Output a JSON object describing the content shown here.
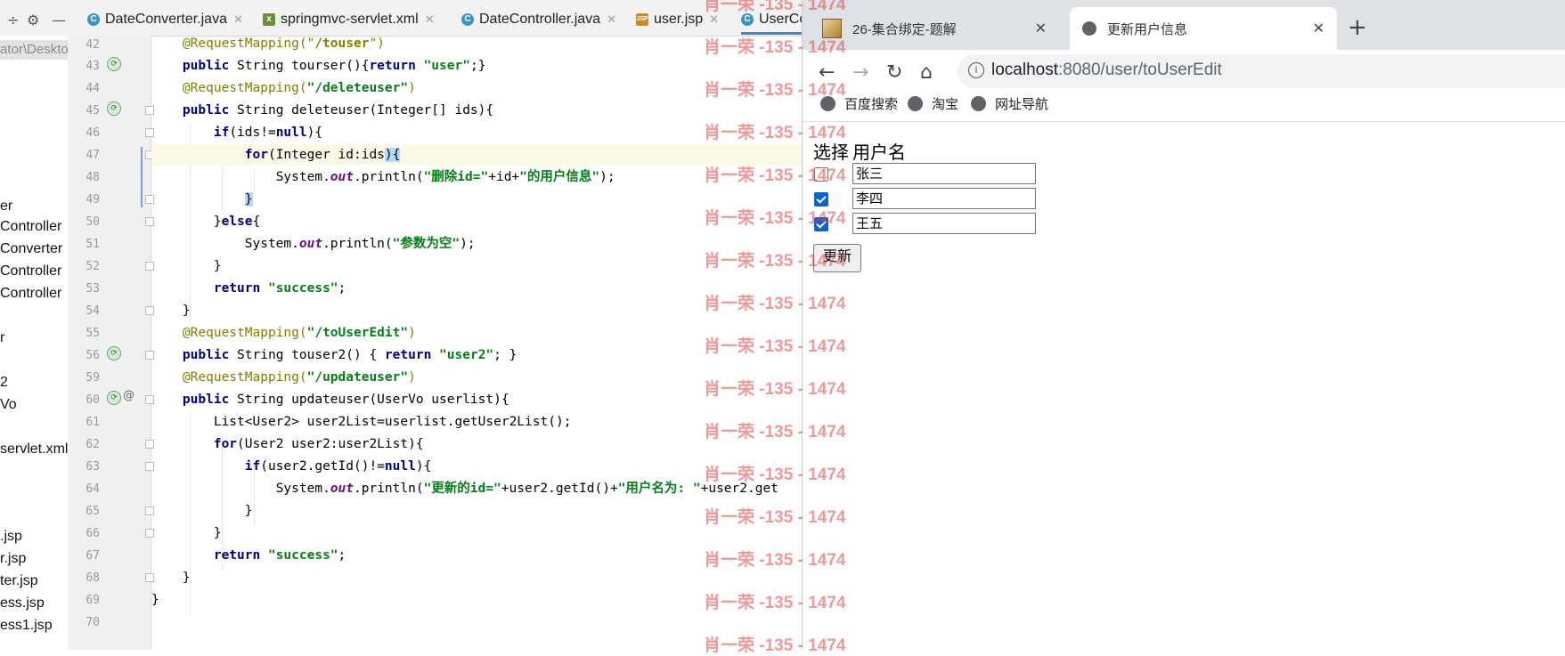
{
  "ide": {
    "tabs": [
      {
        "label": "DateConverter.java",
        "icon": "class-icon"
      },
      {
        "label": "springmvc-servlet.xml",
        "icon": "xml-icon"
      },
      {
        "label": "DateController.java",
        "icon": "class-icon"
      },
      {
        "label": "user.jsp",
        "icon": "jsp-icon"
      },
      {
        "label": "UserCo",
        "icon": "class-icon"
      }
    ],
    "project_path": "ator\\Deskto",
    "project_items": [
      "er",
      "Controller",
      "Converter",
      "Controller",
      "Controller",
      "r",
      "2",
      "Vo",
      "servlet.xml",
      ".jsp",
      "r.jsp",
      "ter.jsp",
      "ess.jsp",
      "ess1.jsp"
    ],
    "line_numbers": [
      "42",
      "43",
      "44",
      "45",
      "46",
      "47",
      "48",
      "49",
      "50",
      "51",
      "52",
      "53",
      "54",
      "55",
      "56",
      "59",
      "60",
      "61",
      "62",
      "63",
      "64",
      "65",
      "66",
      "67",
      "68",
      "69",
      "70"
    ],
    "code": {
      "l42a": "    @RequestMapping(\"",
      "l42b": "/touser",
      "l42c": "\")",
      "l43a": "public",
      "l43b": " String tourser(){",
      "l43c": "return",
      "l43d": "\"user\"",
      "l43e": ";}",
      "l44a": "@RequestMapping(",
      "l44b": "\"/deleteuser\"",
      "l44c": ")",
      "l45a": "public",
      "l45b": " String deleteuser(Integer[] ids){",
      "l46a": "if",
      "l46b": "(ids!=",
      "l46c": "null",
      "l46d": "){",
      "l47a": "for",
      "l47b": "(Integer id:ids",
      "l47c": "){",
      "l48a": "System.",
      "l48b": "out",
      "l48c": ".println(",
      "l48d": "\"删除id=\"",
      "l48e": "+id+",
      "l48f": "\"的用户信息\"",
      "l48g": ");",
      "l49": "}",
      "l50a": "}",
      "l50b": "else",
      "l50c": "{",
      "l51a": "System.",
      "l51b": "out",
      "l51c": ".println(",
      "l51d": "\"参数为空\"",
      "l51e": ");",
      "l52": "}",
      "l53a": "return",
      "l53b": "\"success\"",
      "l53c": ";",
      "l54": "}",
      "l55a": "@RequestMapping(",
      "l55b": "\"/toUserEdit\"",
      "l55c": ")",
      "l56a": "public",
      "l56b": " String touser2() { ",
      "l56c": "return",
      "l56d": "\"user2\"",
      "l56e": "; }",
      "l59a": "@RequestMapping(",
      "l59b": "\"/updateuser\"",
      "l59c": ")",
      "l60a": "public",
      "l60b": " String updateuser(UserVo userlist){",
      "l61": "List<User2> user2List=userlist.getUser2List();",
      "l62a": "for",
      "l62b": "(User2 user2:user2List){",
      "l63a": "if",
      "l63b": "(user2.getId()!=",
      "l63c": "null",
      "l63d": "){",
      "l64a": "System.",
      "l64b": "out",
      "l64c": ".println(",
      "l64d": "\"更新的id=\"",
      "l64e": "+user2.getId()+",
      "l64f": "\"用户名为: \"",
      "l64g": "+user2.get",
      "l65": "}",
      "l66": "}",
      "l67a": "return",
      "l67b": "\"success\"",
      "l67c": ";",
      "l68": "}",
      "l69": "}"
    }
  },
  "browser": {
    "tabs": [
      {
        "title": "26-集合绑定-题解",
        "active": false
      },
      {
        "title": "更新用户信息",
        "active": true
      }
    ],
    "new_tab": "+",
    "url_host": "localhost",
    "url_rest": ":8080/user/toUserEdit",
    "bookmarks": [
      "百度搜索",
      "淘宝",
      "网址导航"
    ],
    "page": {
      "header_select": "选择",
      "header_name": "用户名",
      "rows": [
        {
          "checked": false,
          "name": "张三"
        },
        {
          "checked": true,
          "name": "李四"
        },
        {
          "checked": true,
          "name": "王五"
        }
      ],
      "submit_label": "更新"
    }
  },
  "watermark": "肖一荣 -135 - 1474",
  "colors": {
    "keyword": "#000080",
    "annotation": "#808000",
    "string": "#067d17",
    "watermark": "#e24646",
    "checkbox": "#0b63cf"
  }
}
